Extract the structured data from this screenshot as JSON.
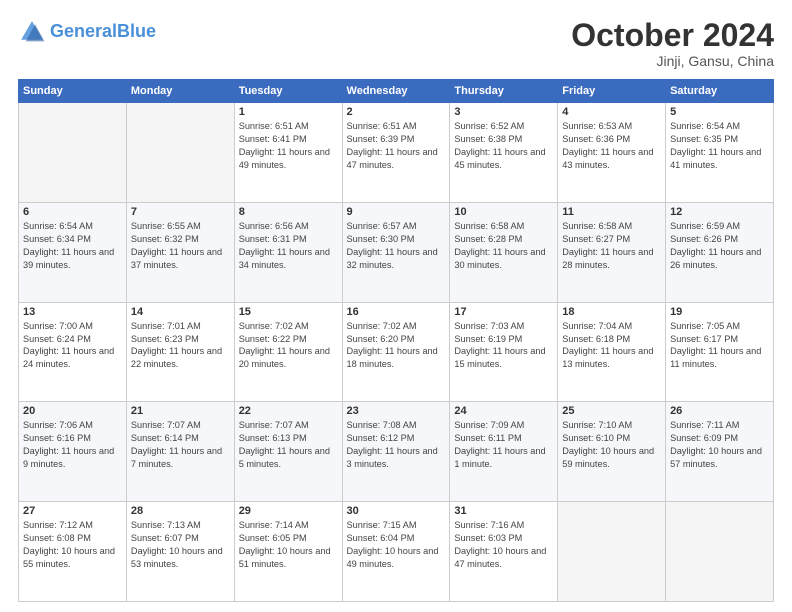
{
  "header": {
    "logo_general": "General",
    "logo_blue": "Blue",
    "month": "October 2024",
    "location": "Jinji, Gansu, China"
  },
  "weekdays": [
    "Sunday",
    "Monday",
    "Tuesday",
    "Wednesday",
    "Thursday",
    "Friday",
    "Saturday"
  ],
  "weeks": [
    [
      {
        "day": "",
        "info": ""
      },
      {
        "day": "",
        "info": ""
      },
      {
        "day": "1",
        "info": "Sunrise: 6:51 AM\nSunset: 6:41 PM\nDaylight: 11 hours and 49 minutes."
      },
      {
        "day": "2",
        "info": "Sunrise: 6:51 AM\nSunset: 6:39 PM\nDaylight: 11 hours and 47 minutes."
      },
      {
        "day": "3",
        "info": "Sunrise: 6:52 AM\nSunset: 6:38 PM\nDaylight: 11 hours and 45 minutes."
      },
      {
        "day": "4",
        "info": "Sunrise: 6:53 AM\nSunset: 6:36 PM\nDaylight: 11 hours and 43 minutes."
      },
      {
        "day": "5",
        "info": "Sunrise: 6:54 AM\nSunset: 6:35 PM\nDaylight: 11 hours and 41 minutes."
      }
    ],
    [
      {
        "day": "6",
        "info": "Sunrise: 6:54 AM\nSunset: 6:34 PM\nDaylight: 11 hours and 39 minutes."
      },
      {
        "day": "7",
        "info": "Sunrise: 6:55 AM\nSunset: 6:32 PM\nDaylight: 11 hours and 37 minutes."
      },
      {
        "day": "8",
        "info": "Sunrise: 6:56 AM\nSunset: 6:31 PM\nDaylight: 11 hours and 34 minutes."
      },
      {
        "day": "9",
        "info": "Sunrise: 6:57 AM\nSunset: 6:30 PM\nDaylight: 11 hours and 32 minutes."
      },
      {
        "day": "10",
        "info": "Sunrise: 6:58 AM\nSunset: 6:28 PM\nDaylight: 11 hours and 30 minutes."
      },
      {
        "day": "11",
        "info": "Sunrise: 6:58 AM\nSunset: 6:27 PM\nDaylight: 11 hours and 28 minutes."
      },
      {
        "day": "12",
        "info": "Sunrise: 6:59 AM\nSunset: 6:26 PM\nDaylight: 11 hours and 26 minutes."
      }
    ],
    [
      {
        "day": "13",
        "info": "Sunrise: 7:00 AM\nSunset: 6:24 PM\nDaylight: 11 hours and 24 minutes."
      },
      {
        "day": "14",
        "info": "Sunrise: 7:01 AM\nSunset: 6:23 PM\nDaylight: 11 hours and 22 minutes."
      },
      {
        "day": "15",
        "info": "Sunrise: 7:02 AM\nSunset: 6:22 PM\nDaylight: 11 hours and 20 minutes."
      },
      {
        "day": "16",
        "info": "Sunrise: 7:02 AM\nSunset: 6:20 PM\nDaylight: 11 hours and 18 minutes."
      },
      {
        "day": "17",
        "info": "Sunrise: 7:03 AM\nSunset: 6:19 PM\nDaylight: 11 hours and 15 minutes."
      },
      {
        "day": "18",
        "info": "Sunrise: 7:04 AM\nSunset: 6:18 PM\nDaylight: 11 hours and 13 minutes."
      },
      {
        "day": "19",
        "info": "Sunrise: 7:05 AM\nSunset: 6:17 PM\nDaylight: 11 hours and 11 minutes."
      }
    ],
    [
      {
        "day": "20",
        "info": "Sunrise: 7:06 AM\nSunset: 6:16 PM\nDaylight: 11 hours and 9 minutes."
      },
      {
        "day": "21",
        "info": "Sunrise: 7:07 AM\nSunset: 6:14 PM\nDaylight: 11 hours and 7 minutes."
      },
      {
        "day": "22",
        "info": "Sunrise: 7:07 AM\nSunset: 6:13 PM\nDaylight: 11 hours and 5 minutes."
      },
      {
        "day": "23",
        "info": "Sunrise: 7:08 AM\nSunset: 6:12 PM\nDaylight: 11 hours and 3 minutes."
      },
      {
        "day": "24",
        "info": "Sunrise: 7:09 AM\nSunset: 6:11 PM\nDaylight: 11 hours and 1 minute."
      },
      {
        "day": "25",
        "info": "Sunrise: 7:10 AM\nSunset: 6:10 PM\nDaylight: 10 hours and 59 minutes."
      },
      {
        "day": "26",
        "info": "Sunrise: 7:11 AM\nSunset: 6:09 PM\nDaylight: 10 hours and 57 minutes."
      }
    ],
    [
      {
        "day": "27",
        "info": "Sunrise: 7:12 AM\nSunset: 6:08 PM\nDaylight: 10 hours and 55 minutes."
      },
      {
        "day": "28",
        "info": "Sunrise: 7:13 AM\nSunset: 6:07 PM\nDaylight: 10 hours and 53 minutes."
      },
      {
        "day": "29",
        "info": "Sunrise: 7:14 AM\nSunset: 6:05 PM\nDaylight: 10 hours and 51 minutes."
      },
      {
        "day": "30",
        "info": "Sunrise: 7:15 AM\nSunset: 6:04 PM\nDaylight: 10 hours and 49 minutes."
      },
      {
        "day": "31",
        "info": "Sunrise: 7:16 AM\nSunset: 6:03 PM\nDaylight: 10 hours and 47 minutes."
      },
      {
        "day": "",
        "info": ""
      },
      {
        "day": "",
        "info": ""
      }
    ]
  ]
}
